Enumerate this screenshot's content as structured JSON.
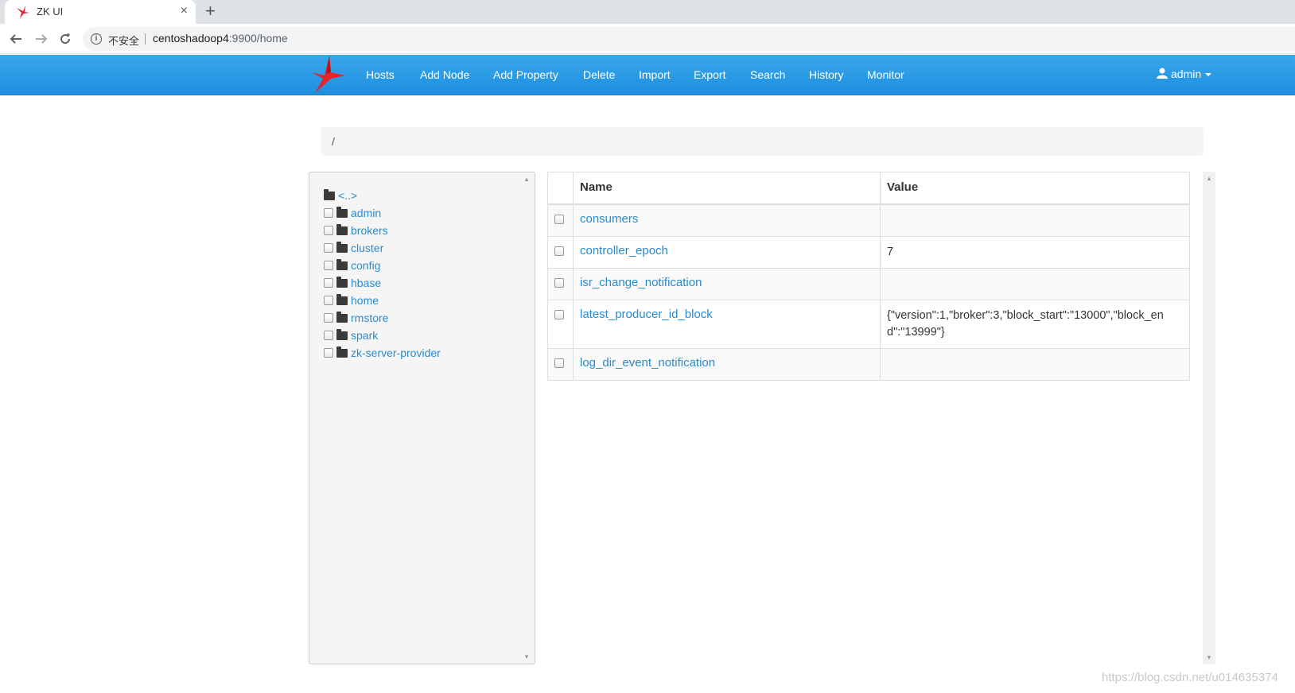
{
  "browser": {
    "tab_title": "ZK UI",
    "tab_close": "×",
    "new_tab": "+",
    "security_label": "不安全",
    "url_host": "centoshadoop4",
    "url_path": ":9900/home"
  },
  "navbar": {
    "items": [
      "Hosts",
      "Add Node",
      "Add Property",
      "Delete",
      "Import",
      "Export",
      "Search",
      "History",
      "Monitor"
    ],
    "user": "admin"
  },
  "breadcrumb": "/",
  "tree": {
    "parent": "<..>",
    "nodes": [
      "admin",
      "brokers",
      "cluster",
      "config",
      "hbase",
      "home",
      "rmstore",
      "spark",
      "zk-server-provider"
    ]
  },
  "table": {
    "headers": {
      "name": "Name",
      "value": "Value"
    },
    "rows": [
      {
        "name": "consumers",
        "value": ""
      },
      {
        "name": "controller_epoch",
        "value": "7"
      },
      {
        "name": "isr_change_notification",
        "value": ""
      },
      {
        "name": "latest_producer_id_block",
        "value": "{\"version\":1,\"broker\":3,\"block_start\":\"13000\",\"block_end\":\"13999\"}"
      },
      {
        "name": "log_dir_event_notification",
        "value": ""
      }
    ]
  },
  "watermark": "https://blog.csdn.net/u014635374",
  "colors": {
    "navbar": "#2a9be6",
    "link": "#2a8bcc",
    "logo": "#e8232b"
  },
  "icons": [
    "zk-bird-logo-icon",
    "folder-icon",
    "user-icon",
    "info-icon",
    "back-arrow-icon",
    "forward-arrow-icon",
    "reload-icon"
  ]
}
